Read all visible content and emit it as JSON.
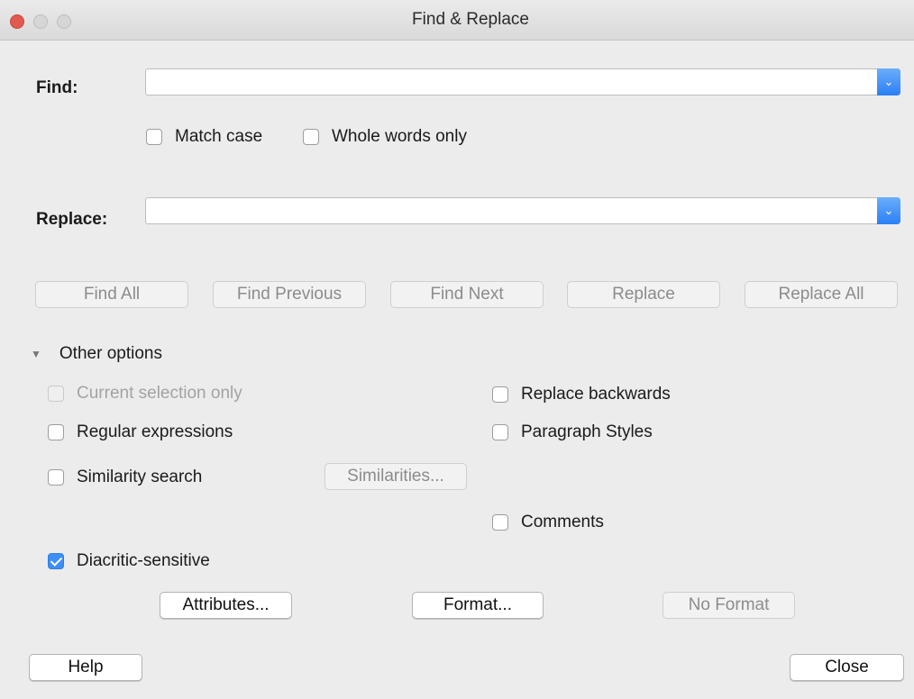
{
  "window": {
    "title": "Find & Replace"
  },
  "find": {
    "label": "Find:",
    "value": "",
    "match_case": "Match case",
    "whole_words": "Whole words only"
  },
  "replace": {
    "label": "Replace:",
    "value": ""
  },
  "actions": {
    "find_all": "Find All",
    "find_previous": "Find Previous",
    "find_next": "Find Next",
    "replace": "Replace",
    "replace_all": "Replace All"
  },
  "other_options": {
    "label": "Other options",
    "current_selection_only": "Current selection only",
    "regular_expressions": "Regular expressions",
    "similarity_search": "Similarity search",
    "similarities_button": "Similarities...",
    "diacritic_sensitive": "Diacritic-sensitive",
    "replace_backwards": "Replace backwards",
    "paragraph_styles": "Paragraph Styles",
    "comments": "Comments",
    "attributes_button": "Attributes...",
    "format_button": "Format...",
    "no_format_button": "No Format"
  },
  "footer": {
    "help": "Help",
    "close": "Close"
  },
  "colors": {
    "accent": "#3d8ef7",
    "close_light": "#e05a4f"
  }
}
